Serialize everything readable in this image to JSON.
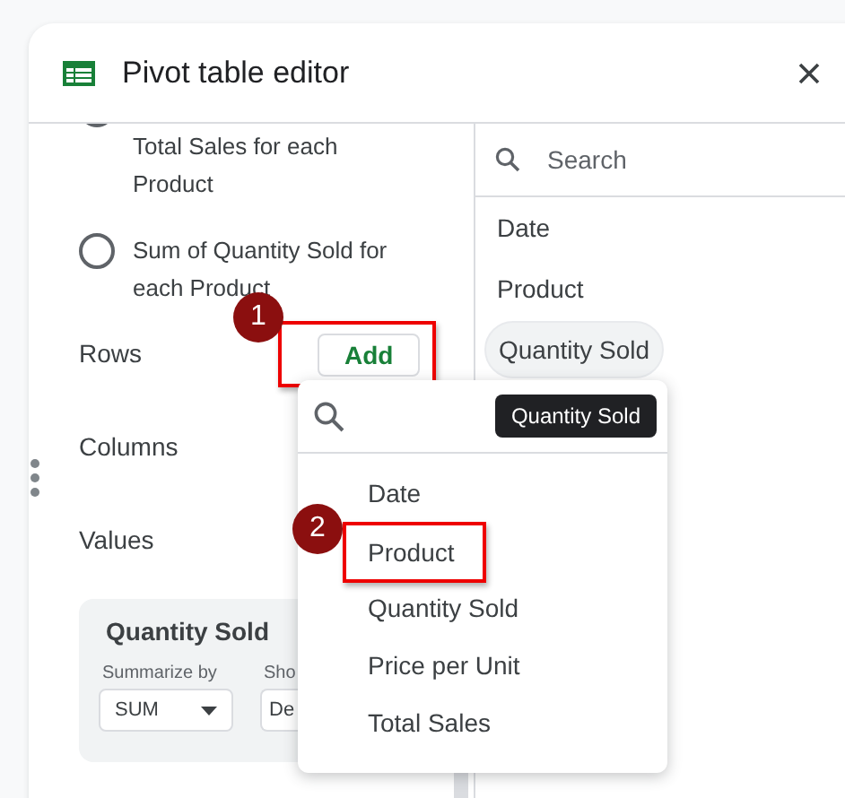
{
  "title": "Pivot table editor",
  "suggestions": [
    {
      "text": "Total Sales for each Product",
      "selected": false
    },
    {
      "text": "Sum of Quantity Sold for each Product",
      "selected": false
    }
  ],
  "sections": [
    {
      "label": "Rows",
      "add_button": {
        "label": "Add",
        "highlighted": true,
        "badge": "1"
      }
    },
    {
      "label": "Columns"
    },
    {
      "label": "Values"
    }
  ],
  "value_card": {
    "title": "Quantity Sold",
    "summarize_label": "Summarize by",
    "summarize_value": "SUM",
    "show_label": "Sho",
    "show_value": "De"
  },
  "field_search": {
    "placeholder": "Search"
  },
  "fields": [
    {
      "name": "Date",
      "hovered": false
    },
    {
      "name": "Product",
      "hovered": false
    },
    {
      "name": "Quantity Sold",
      "hovered": true
    }
  ],
  "dropdown": {
    "tooltip": "Quantity Sold",
    "items": [
      {
        "label": "Date",
        "highlighted": false
      },
      {
        "label": "Product",
        "highlighted": true,
        "badge": "2"
      },
      {
        "label": "Quantity Sold",
        "highlighted": false
      },
      {
        "label": "Price per Unit",
        "highlighted": false
      },
      {
        "label": "Total Sales",
        "highlighted": false
      }
    ]
  }
}
